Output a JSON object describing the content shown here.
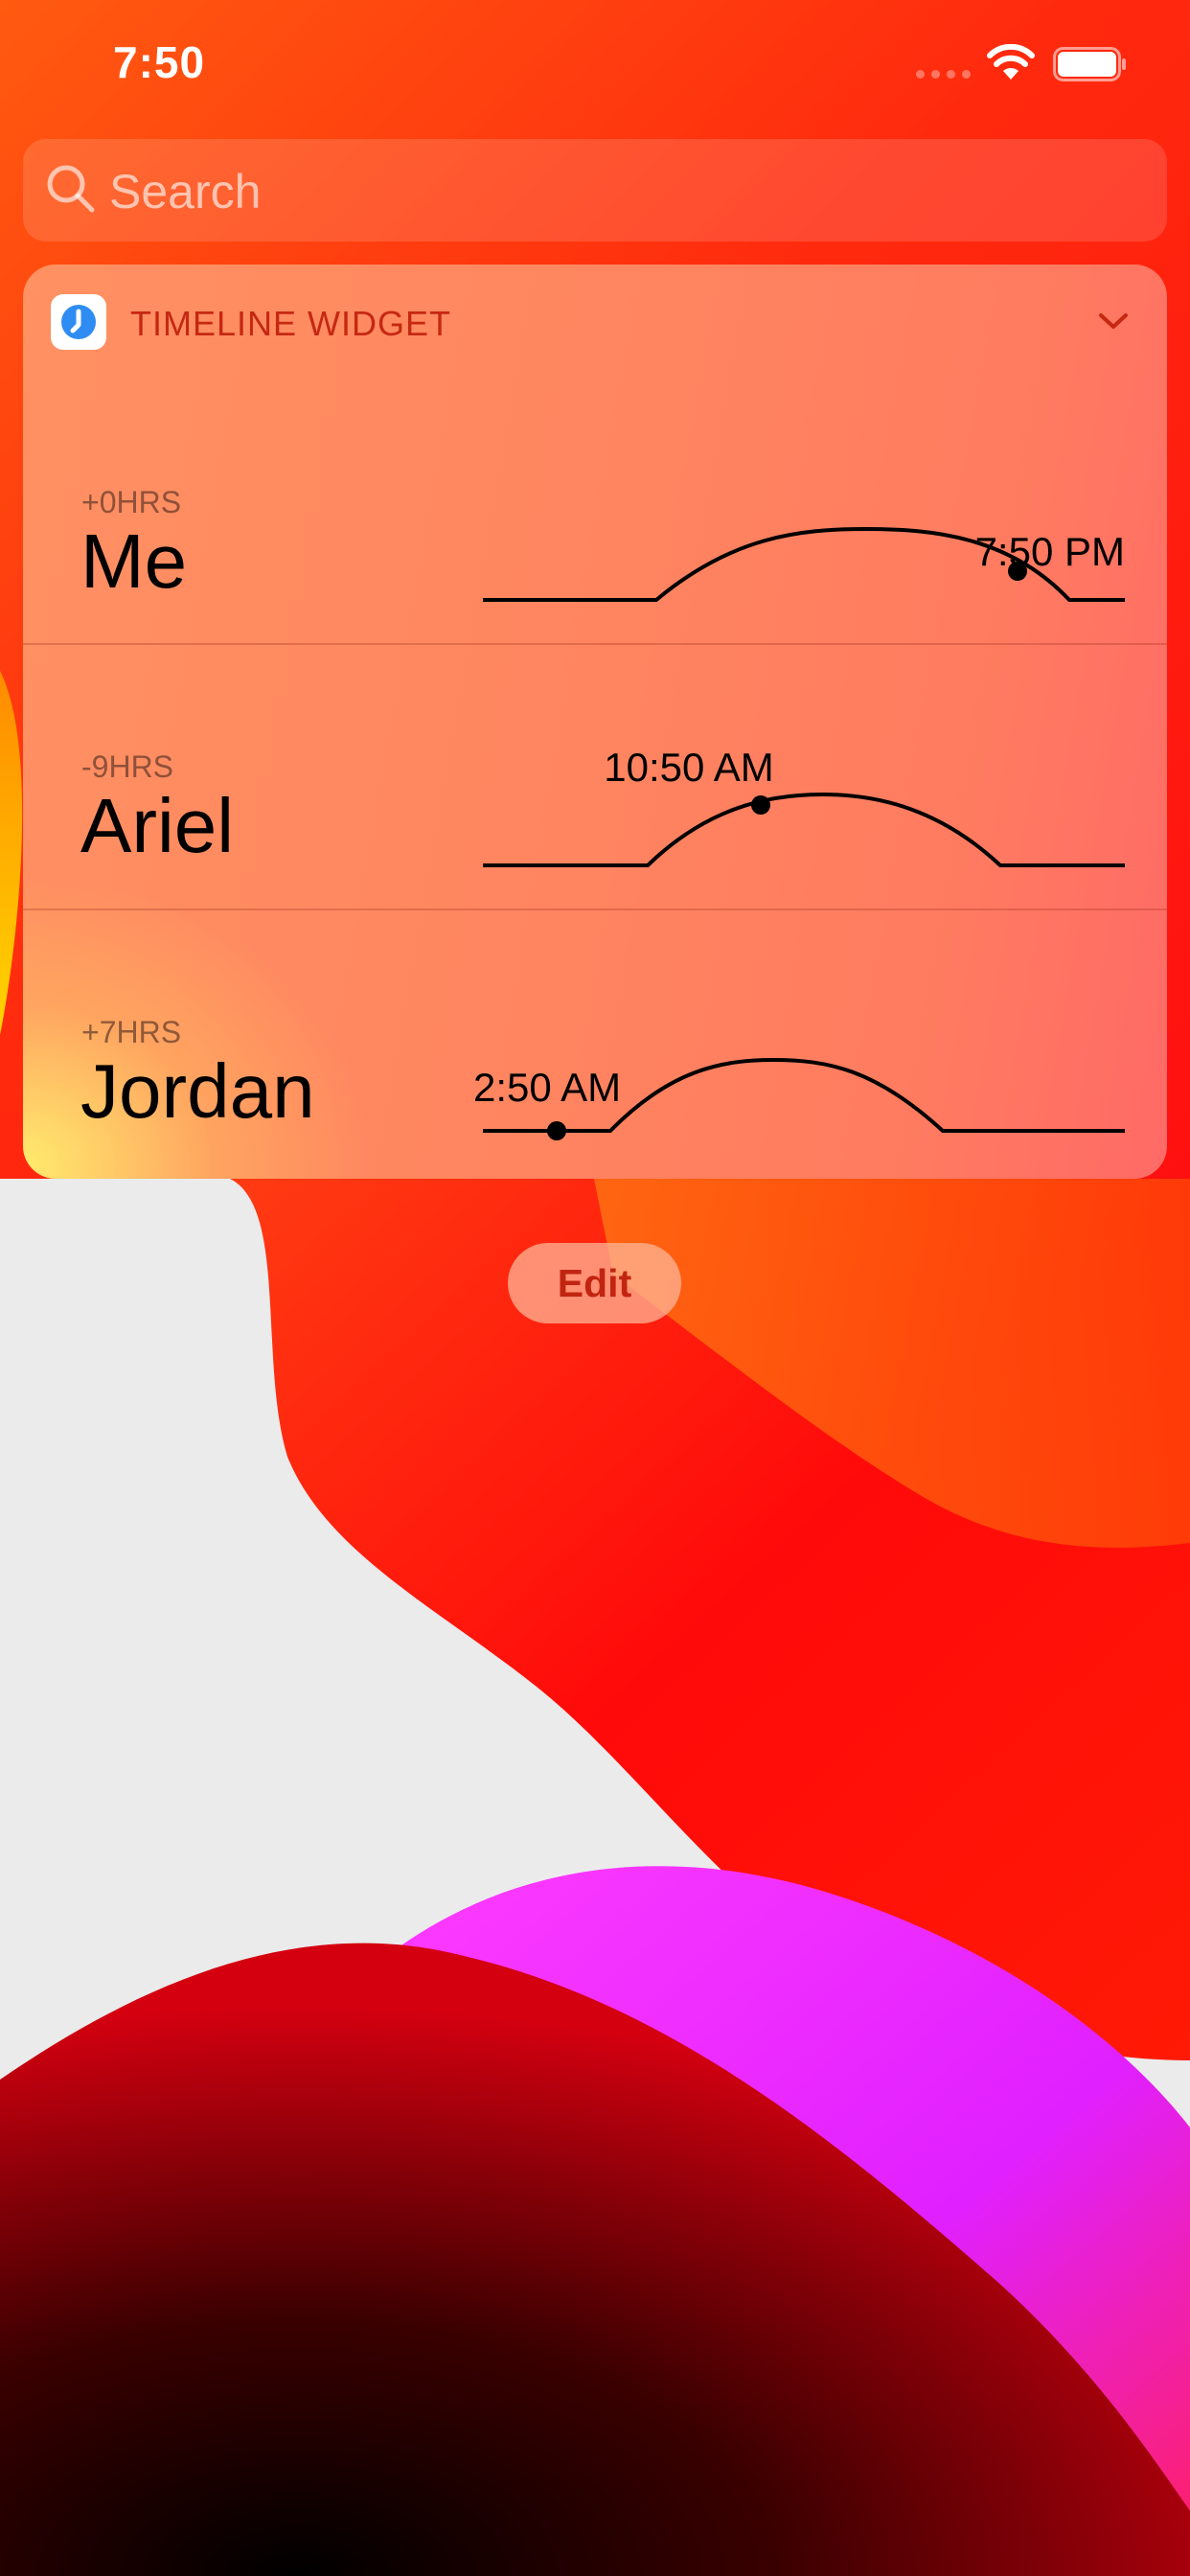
{
  "status_bar": {
    "time": "7:50"
  },
  "search": {
    "placeholder": "Search"
  },
  "widget": {
    "title": "TIMELINE WIDGET",
    "icon": "clock-app-icon",
    "rows": [
      {
        "offset": "+0HRS",
        "name": "Me",
        "time": "7:50 PM",
        "day_fraction": 0.83
      },
      {
        "offset": "-9HRS",
        "name": "Ariel",
        "time": "10:50 AM",
        "day_fraction": 0.45
      },
      {
        "offset": "+7HRS",
        "name": "Jordan",
        "time": "2:50 AM",
        "day_fraction": 0.11
      }
    ]
  },
  "edit_button": {
    "label": "Edit"
  }
}
